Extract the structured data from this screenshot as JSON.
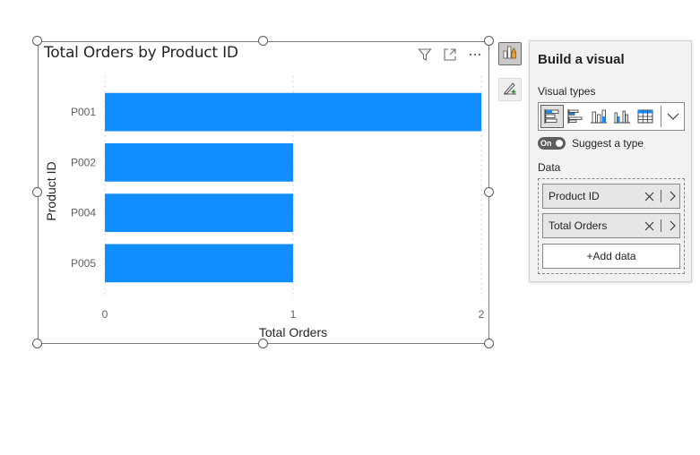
{
  "visual": {
    "title": "Total Orders by Product ID",
    "header_icons": [
      "filter-icon",
      "focus-mode-icon",
      "more-options-icon"
    ]
  },
  "chart_data": {
    "type": "bar",
    "orientation": "horizontal",
    "categories": [
      "P001",
      "P002",
      "P004",
      "P005"
    ],
    "values": [
      2,
      1,
      1,
      1
    ],
    "xlabel": "Total Orders",
    "ylabel": "Product ID",
    "xlim": [
      0,
      2
    ],
    "xticks": [
      "0",
      "1",
      "2"
    ],
    "bar_color": "#118DFF",
    "grid": "vertical dotted"
  },
  "side_toolbar": {
    "build_icon": "build-visual-icon",
    "format_icon": "format-visual-icon"
  },
  "pane": {
    "title": "Build a visual",
    "visual_types_label": "Visual types",
    "visual_types": [
      "stacked-bar-chart-icon",
      "clustered-bar-chart-icon",
      "stacked-column-chart-icon",
      "clustered-column-chart-icon",
      "table-icon"
    ],
    "selected_visual_type": "stacked-bar-chart-icon",
    "suggest_toggle_state": "On",
    "suggest_label": "Suggest a type",
    "data_label": "Data",
    "fields": [
      {
        "label": "Product ID"
      },
      {
        "label": "Total Orders"
      }
    ],
    "add_data_label": "+Add data"
  },
  "colors": {
    "accent": "#118DFF",
    "pane_bg": "#F3F2F1",
    "toggle": "#605E5C"
  }
}
